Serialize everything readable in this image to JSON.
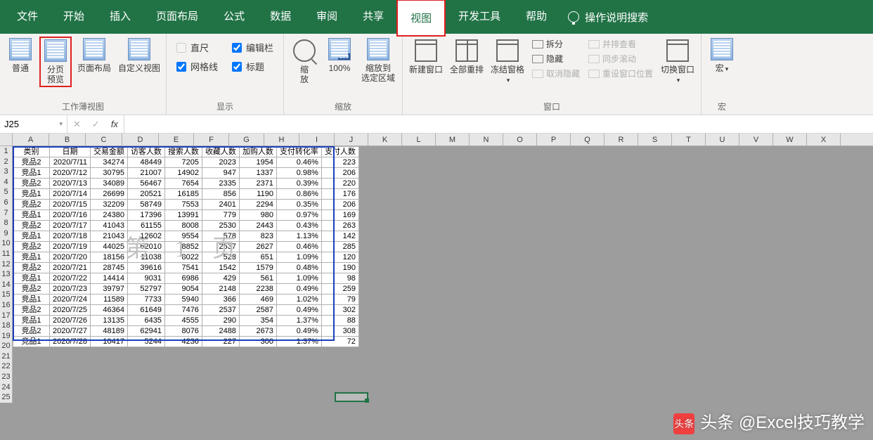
{
  "tabs": {
    "items": [
      "文件",
      "开始",
      "插入",
      "页面布局",
      "公式",
      "数据",
      "审阅",
      "共享",
      "视图",
      "开发工具",
      "帮助"
    ],
    "active_index": 8,
    "tell_me": "操作说明搜索"
  },
  "ribbon": {
    "group_views": {
      "label": "工作薄视图",
      "normal": "普通",
      "page_break": "分页\n预览",
      "page_layout": "页面布局",
      "custom": "自定义视图"
    },
    "group_show": {
      "label": "显示",
      "ruler": "直尺",
      "formula_bar": "编辑栏",
      "gridlines": "网格线",
      "headings": "标题"
    },
    "group_zoom": {
      "label": "缩放",
      "zoom": "缩\n放",
      "hundred": "100%",
      "to_selection": "缩放到\n选定区域"
    },
    "group_window": {
      "label": "窗口",
      "new_win": "新建窗口",
      "arrange": "全部重排",
      "freeze": "冻结窗格",
      "split": "拆分",
      "hide": "隐藏",
      "unhide": "取消隐藏",
      "side": "并排查看",
      "sync": "同步滚动",
      "reset": "重设窗口位置",
      "switch": "切换窗口"
    },
    "group_macro": {
      "label": "宏",
      "macro": "宏"
    }
  },
  "formula_bar": {
    "name": "J25",
    "fx": "fx",
    "value": ""
  },
  "sheet": {
    "columns": [
      "A",
      "B",
      "C",
      "D",
      "E",
      "F",
      "G",
      "H",
      "I",
      "J",
      "K",
      "L",
      "M",
      "N",
      "O",
      "P",
      "Q",
      "R",
      "S",
      "T",
      "U",
      "V",
      "W",
      "X"
    ],
    "headers": [
      "类别",
      "日期",
      "交易金额",
      "访客人数",
      "搜索人数",
      "收藏人数",
      "加购人数",
      "支付转化率",
      "支付人数"
    ],
    "rows": [
      [
        "竞品2",
        "2020/7/11",
        "34274",
        "48449",
        "7205",
        "2023",
        "1954",
        "0.46%",
        "223"
      ],
      [
        "竞品1",
        "2020/7/12",
        "30795",
        "21007",
        "14902",
        "947",
        "1337",
        "0.98%",
        "206"
      ],
      [
        "竞品2",
        "2020/7/13",
        "34089",
        "56467",
        "7654",
        "2335",
        "2371",
        "0.39%",
        "220"
      ],
      [
        "竞品1",
        "2020/7/14",
        "26699",
        "20521",
        "16185",
        "856",
        "1190",
        "0.86%",
        "176"
      ],
      [
        "竞品2",
        "2020/7/15",
        "32209",
        "58749",
        "7553",
        "2401",
        "2294",
        "0.35%",
        "206"
      ],
      [
        "竞品1",
        "2020/7/16",
        "24380",
        "17396",
        "13991",
        "779",
        "980",
        "0.97%",
        "169"
      ],
      [
        "竞品2",
        "2020/7/17",
        "41043",
        "61155",
        "8008",
        "2530",
        "2443",
        "0.43%",
        "263"
      ],
      [
        "竞品1",
        "2020/7/18",
        "21043",
        "12602",
        "9554",
        "578",
        "823",
        "1.13%",
        "142"
      ],
      [
        "竞品2",
        "2020/7/19",
        "44025",
        "62010",
        "8852",
        "2537",
        "2627",
        "0.46%",
        "285"
      ],
      [
        "竞品1",
        "2020/7/20",
        "18156",
        "11038",
        "8022",
        "528",
        "651",
        "1.09%",
        "120"
      ],
      [
        "竞品2",
        "2020/7/21",
        "28745",
        "39616",
        "7541",
        "1542",
        "1579",
        "0.48%",
        "190"
      ],
      [
        "竞品1",
        "2020/7/22",
        "14414",
        "9031",
        "6986",
        "429",
        "561",
        "1.09%",
        "98"
      ],
      [
        "竞品2",
        "2020/7/23",
        "39797",
        "52797",
        "9054",
        "2148",
        "2238",
        "0.49%",
        "259"
      ],
      [
        "竞品1",
        "2020/7/24",
        "11589",
        "7733",
        "5940",
        "366",
        "469",
        "1.02%",
        "79"
      ],
      [
        "竞品2",
        "2020/7/25",
        "46364",
        "61649",
        "7476",
        "2537",
        "2587",
        "0.49%",
        "302"
      ],
      [
        "竞品1",
        "2020/7/26",
        "13135",
        "6435",
        "4555",
        "290",
        "354",
        "1.37%",
        "88"
      ],
      [
        "竞品2",
        "2020/7/27",
        "48189",
        "62941",
        "8076",
        "2488",
        "2673",
        "0.49%",
        "308"
      ],
      [
        "竞品1",
        "2020/7/28",
        "10417",
        "5244",
        "4236",
        "227",
        "300",
        "1.37%",
        "72"
      ]
    ],
    "watermark": "第 1 页",
    "selected_cell": "J25"
  },
  "credit": "头条 @Excel技巧教学"
}
